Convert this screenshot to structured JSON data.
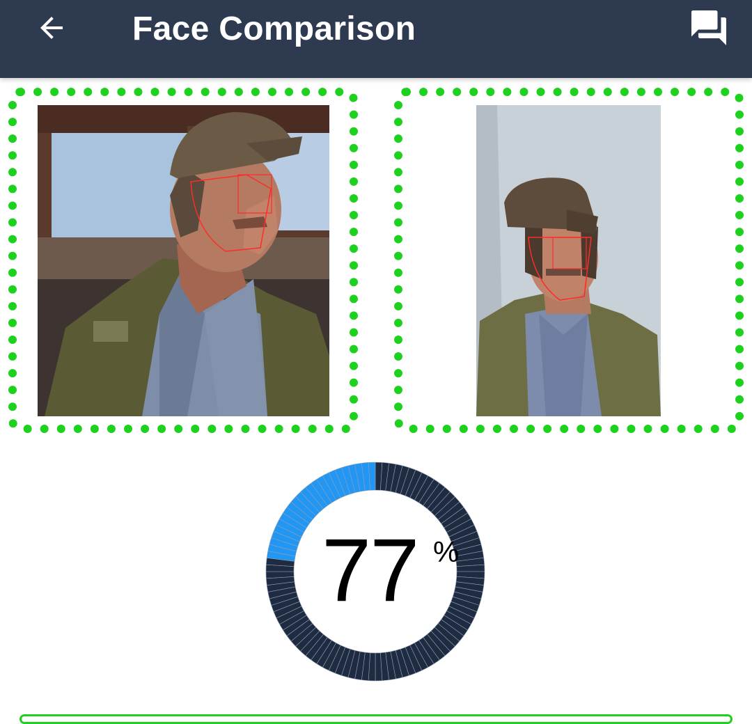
{
  "appbar": {
    "title": "Face Comparison",
    "back_icon": "arrow-left-icon",
    "help_icon": "question-answer-icon",
    "background": "#2e3a4f"
  },
  "photos": [
    {
      "slot": "left",
      "description_icon": "face-photo"
    },
    {
      "slot": "right",
      "description_icon": "face-photo"
    }
  ],
  "frame_color": "#1fd11f",
  "gauge": {
    "value": "77",
    "unit": "%",
    "percent": 77,
    "active_color": "#2196f3",
    "track_color": "#1f2b40"
  }
}
